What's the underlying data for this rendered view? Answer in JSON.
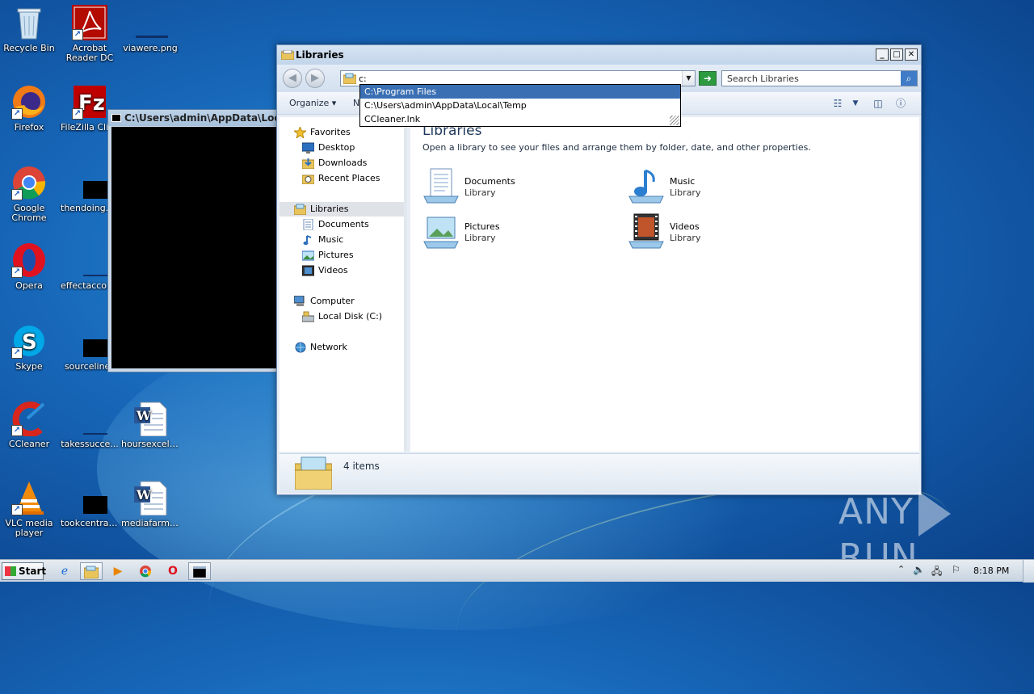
{
  "desktop": {
    "icons": [
      {
        "label": "Recycle Bin"
      },
      {
        "label": "Acrobat Reader DC"
      },
      {
        "label": "viawere.png"
      },
      {
        "label": "Firefox"
      },
      {
        "label": "FileZilla Client"
      },
      {
        "label": "Google Chrome"
      },
      {
        "label": "thendoing.jpg"
      },
      {
        "label": "Opera"
      },
      {
        "label": "effectaccount"
      },
      {
        "label": "Skype"
      },
      {
        "label": "sourcelines"
      },
      {
        "label": "CCleaner"
      },
      {
        "label": "takessucce..."
      },
      {
        "label": "hoursexcell..."
      },
      {
        "label": "VLC media player"
      },
      {
        "label": "tookcentral..."
      },
      {
        "label": "mediafarm.rtf"
      }
    ]
  },
  "console_window": {
    "title": "C:\\Users\\admin\\AppData\\Local\\"
  },
  "explorer": {
    "title": "Libraries",
    "address_value": "c:",
    "search_placeholder": "Search Libraries",
    "autocomplete": [
      "C:\\Program Files",
      "C:\\Users\\admin\\AppData\\Local\\Temp",
      "CCleaner.lnk"
    ],
    "toolbar": {
      "organize": "Organize",
      "new_partial": "N"
    },
    "nav": {
      "favorites": "Favorites",
      "desktop": "Desktop",
      "downloads": "Downloads",
      "recent_places": "Recent Places",
      "libraries": "Libraries",
      "documents": "Documents",
      "music": "Music",
      "pictures": "Pictures",
      "videos": "Videos",
      "computer": "Computer",
      "local_disk": "Local Disk (C:)",
      "network": "Network"
    },
    "content": {
      "heading": "Libraries",
      "subheading": "Open a library to see your files and arrange them by folder, date, and other properties.",
      "libraries": [
        {
          "name": "Documents",
          "type": "Library"
        },
        {
          "name": "Music",
          "type": "Library"
        },
        {
          "name": "Pictures",
          "type": "Library"
        },
        {
          "name": "Videos",
          "type": "Library"
        }
      ]
    },
    "status": "4 items"
  },
  "taskbar": {
    "start_label": "Start",
    "clock": "8:18 PM"
  },
  "watermark": {
    "left": "ANY",
    "right": "RUN"
  }
}
